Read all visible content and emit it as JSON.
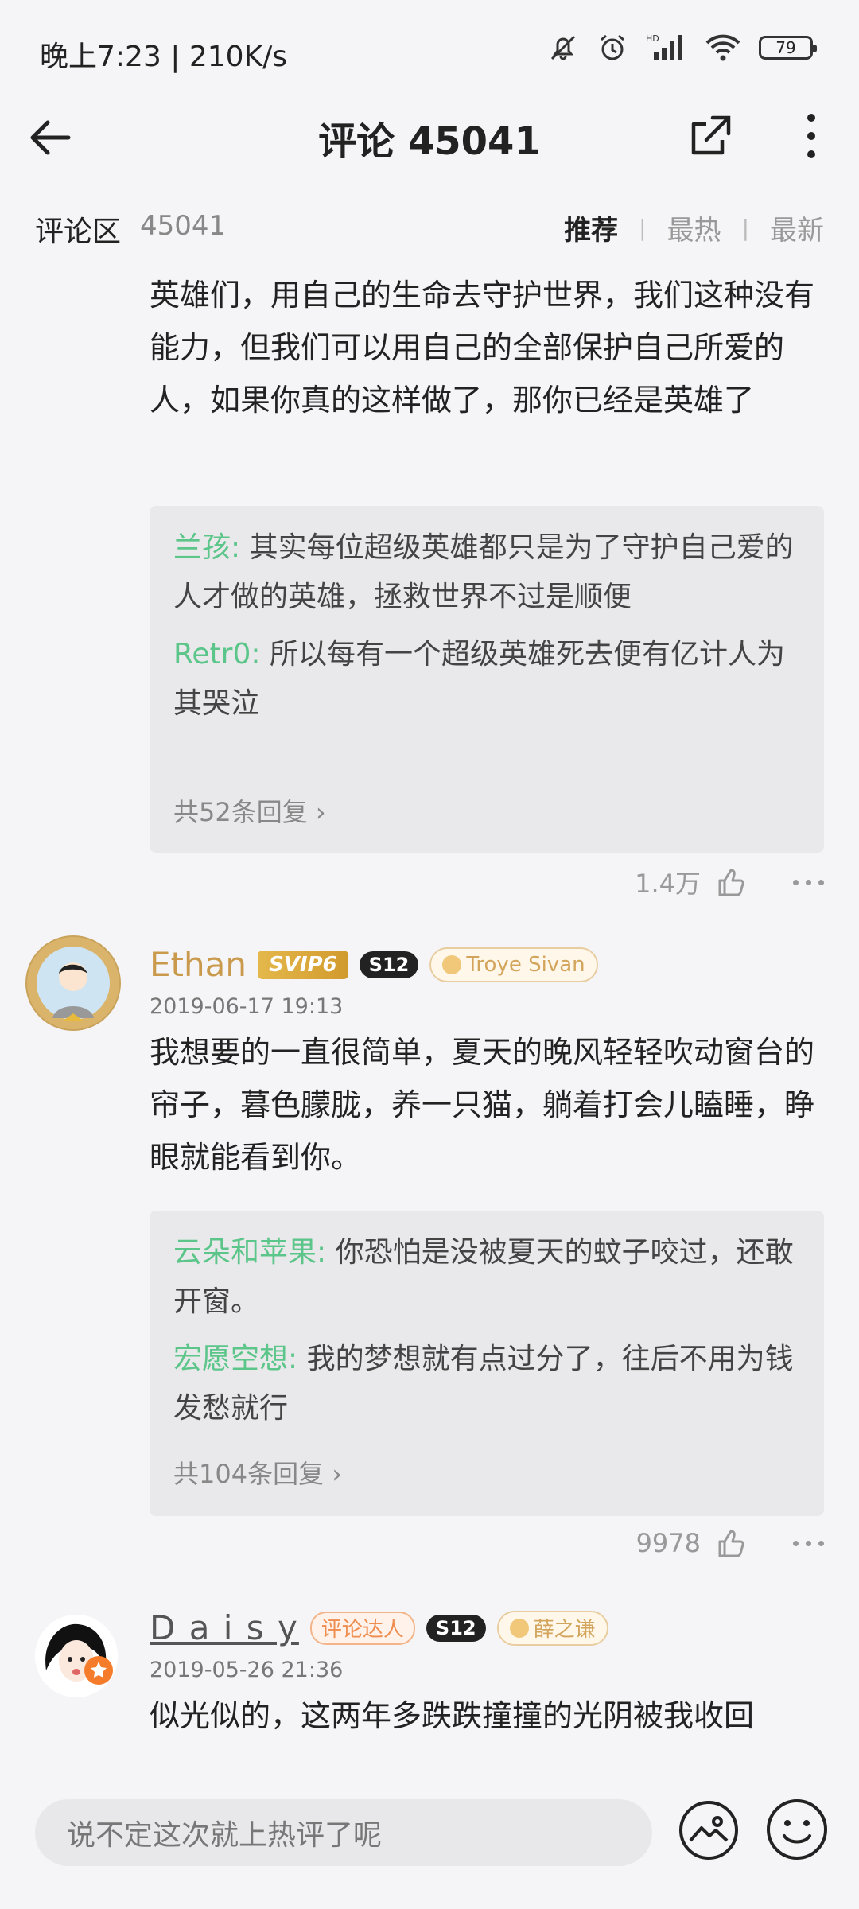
{
  "status": {
    "time": "晚上7:23 | 210K/s",
    "battery": "79"
  },
  "header": {
    "title": "评论 45041"
  },
  "section": {
    "title": "评论区",
    "count": "45041",
    "sort": {
      "recommend": "推荐",
      "sep1": "|",
      "hot": "最热",
      "sep2": "|",
      "new": "最新"
    }
  },
  "comments": [
    {
      "text": "英雄们，用自己的生命去守护世界，我们这种没有能力，但我们可以用自己的全部保护自己所爱的人，如果你真的这样做了，那你已经是英雄了",
      "replies": [
        {
          "user": "兰孩:",
          "text": " 其实每位超级英雄都只是为了守护自己爱的人才做的英雄，拯救世界不过是顺便"
        },
        {
          "user": "Retr0:",
          "text": " 所以每有一个超级英雄死去便有亿计人为其哭泣"
        }
      ],
      "reply_more": "共52条回复 ›",
      "likes": "1.4万"
    },
    {
      "username": "Ethan",
      "vip": "SVIP6",
      "level": "S12",
      "fan_badge": "Troye Sivan",
      "date": "2019-06-17 19:13",
      "text": "我想要的一直很简单，夏天的晚风轻轻吹动窗台的帘子，暮色朦胧，养一只猫，躺着打会儿瞌睡，睁眼就能看到你。",
      "replies": [
        {
          "user": "云朵和苹果:",
          "text": " 你恐怕是没被夏天的蚊子咬过，还敢开窗。"
        },
        {
          "user": "宏愿空想:",
          "text": " 我的梦想就有点过分了，往后不用为钱发愁就行"
        }
      ],
      "reply_more": "共104条回复 ›",
      "likes": "9978"
    },
    {
      "username": "D a i s y",
      "talent": "评论达人",
      "level": "S12",
      "fan_badge": "薛之谦",
      "date": "2019-05-26 21:36",
      "text": "似光似的，这两年多跌跌撞撞的光阴被我收回"
    }
  ],
  "input": {
    "placeholder": "说不定这次就上热评了呢"
  }
}
